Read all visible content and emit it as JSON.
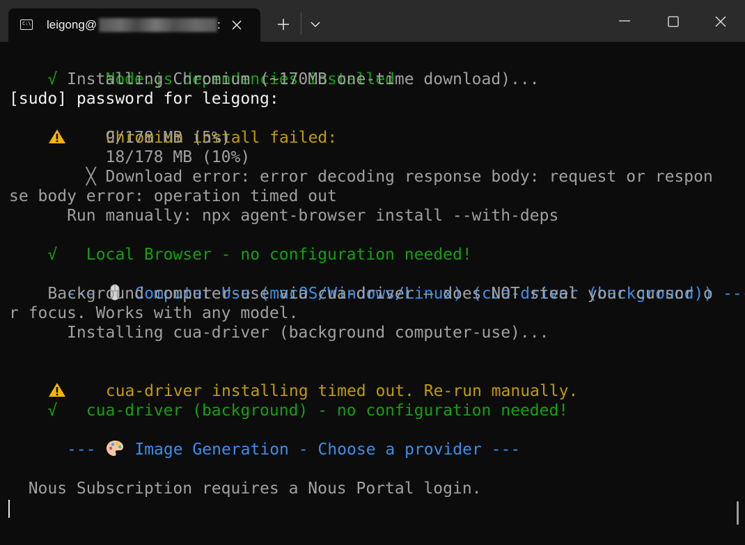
{
  "window": {
    "tab_title": "leigong@",
    "tab_title_tail": ":",
    "terminal_icon": "command-prompt-icon",
    "buttons": {
      "close_tab": "close-icon",
      "new_tab": "plus-icon",
      "dropdown": "chevron-down-icon",
      "minimize": "minimize-icon",
      "maximize": "maximize-icon",
      "close_window": "close-icon"
    }
  },
  "colors": {
    "background": "#0c0c0c",
    "titlebar": "#2b2b2b",
    "success_green": "#13a10e",
    "warning_yellow": "#c19c00",
    "section_blue": "#3b8eea",
    "text_gray": "#a0a0a0",
    "text_white": "#f2f2f2"
  },
  "terminal": {
    "lines": [
      {
        "prefix": "√",
        "text": "     Node.js dependencies installed"
      },
      {
        "text": "      Installing Chromium (~170MB one-time download)..."
      },
      {
        "text": "[sudo] password for leigong:"
      },
      {
        "icon": "warning-icon",
        "text": "    Chromium install failed:"
      },
      {
        "text": "          9/178 MB (5%)"
      },
      {
        "text": "          18/178 MB (10%)"
      },
      {
        "text": "        ╳ Download error: error decoding response body: request or respon"
      },
      {
        "text": "se body error: operation timed out"
      },
      {
        "text": "      Run manually: npx agent-browser install --with-deps"
      },
      {
        "prefix": "√",
        "text": "   Local Browser - no configuration needed!"
      },
      {
        "text": ""
      },
      {
        "prefix": "  --- ",
        "icon": "mouse-icon",
        "text": " Computer Use (macOS/Windows/Linux) (cua-driver (background)) ---"
      },
      {
        "text": "    Background computer-use via cua-driver — does NOT steal your cursor o"
      },
      {
        "text": "r focus. Works with any model."
      },
      {
        "text": "      Installing cua-driver (background computer-use)..."
      },
      {
        "text": ""
      },
      {
        "icon": "warning-icon",
        "text": "    cua-driver installing timed out. Re-run manually."
      },
      {
        "prefix": "√",
        "text": "   cua-driver (background) - no configuration needed!"
      },
      {
        "text": ""
      },
      {
        "prefix": "  --- ",
        "icon": "palette-icon",
        "text": " Image Generation - Choose a provider ---"
      },
      {
        "text": ""
      },
      {
        "text": ""
      },
      {
        "text": "  Nous Subscription requires a Nous Portal login."
      }
    ]
  }
}
